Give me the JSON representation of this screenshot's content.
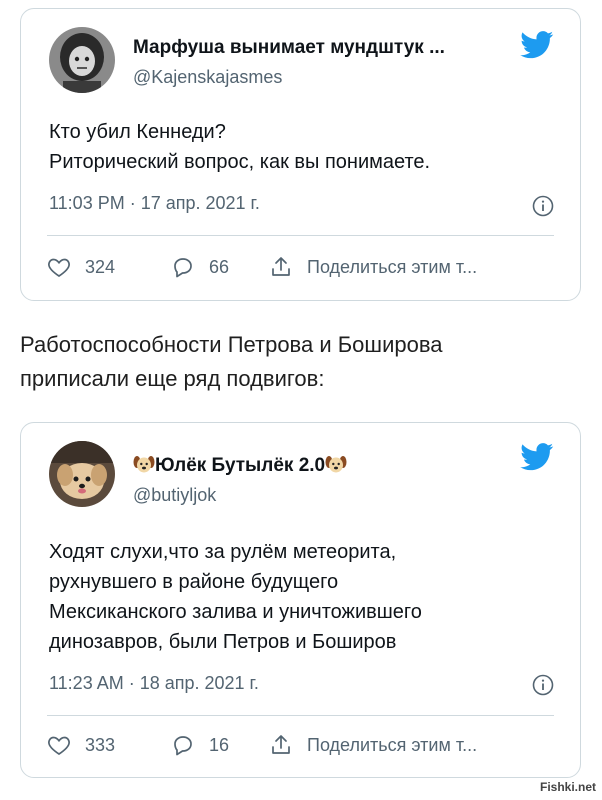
{
  "tweet1": {
    "name": "Марфуша вынимает мундштук ...",
    "handle": "@Kajenskajasmes",
    "text_lines": [
      "Кто убил Кеннеди?",
      "Риторический вопрос, как вы понимаете."
    ],
    "timestamp": "11:03 PM · 17 апр. 2021 г.",
    "likes": "324",
    "replies": "66",
    "share_label": "Поделиться этим т..."
  },
  "caption_lines": [
    "Работоспособности Петрова и Боширова",
    "приписали еще ряд подвигов:"
  ],
  "tweet2": {
    "name": "Юлёк Бутылёк 2.0",
    "handle": "@butiyljok",
    "text_lines": [
      "Ходят слухи,что за рулём метеорита,",
      "рухнувшего в районе будущего",
      "Мексиканского залива и уничтожившего",
      "динозавров, были Петров и Боширов"
    ],
    "timestamp": "11:23 AM · 18 апр. 2021 г.",
    "likes": "333",
    "replies": "16",
    "share_label": "Поделиться этим т..."
  },
  "watermark": "Fishki.net",
  "icons": {
    "bird": "twitter-bird-icon",
    "like": "heart-icon",
    "reply": "reply-bubble-icon",
    "share": "share-icon",
    "info": "info-icon",
    "emoji": "dog-face-emoji"
  },
  "colors": {
    "twitter_blue": "#1d9bf0",
    "secondary_text": "#536471",
    "border": "#cfd9de"
  }
}
